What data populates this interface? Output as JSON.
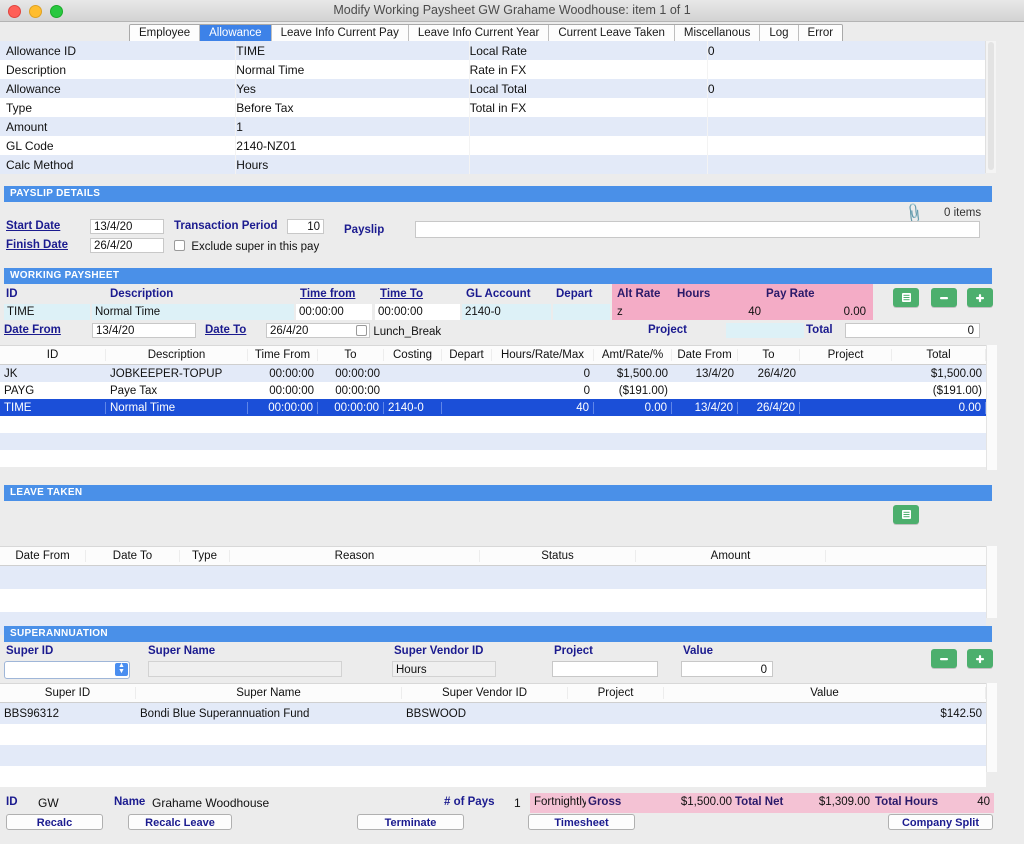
{
  "window": {
    "title": "Modify Working Paysheet GW Grahame Woodhouse: item 1  of  1"
  },
  "tabs": [
    {
      "label": "Employee",
      "active": false
    },
    {
      "label": "Allowance",
      "active": true
    },
    {
      "label": "Leave Info Current Pay",
      "active": false
    },
    {
      "label": "Leave Info Current Year",
      "active": false
    },
    {
      "label": "Current Leave Taken",
      "active": false
    },
    {
      "label": "Miscellanous",
      "active": false
    },
    {
      "label": "Log",
      "active": false
    },
    {
      "label": "Error",
      "active": false
    }
  ],
  "allowance_detail": {
    "left": [
      {
        "label": "Allowance ID",
        "value": "TIME"
      },
      {
        "label": "Description",
        "value": "Normal Time"
      },
      {
        "label": "Allowance",
        "value": "Yes"
      },
      {
        "label": "Type",
        "value": "Before Tax"
      },
      {
        "label": "Amount",
        "value": "1"
      },
      {
        "label": "GL Code",
        "value": "2140-NZ01"
      },
      {
        "label": "Calc Method",
        "value": "Hours"
      }
    ],
    "right": [
      {
        "label": "Local Rate",
        "value": "0"
      },
      {
        "label": "Rate in FX",
        "value": ""
      },
      {
        "label": "Local Total",
        "value": "0"
      },
      {
        "label": "Total in FX",
        "value": ""
      },
      {
        "label": "",
        "value": ""
      },
      {
        "label": "",
        "value": ""
      },
      {
        "label": "",
        "value": ""
      }
    ]
  },
  "payslip_details": {
    "section_title": "PAYSLIP DETAILS",
    "attachment_count": "0 items",
    "attachment_icon": "paperclip-icon",
    "start_date_label": "Start Date",
    "start_date_value": "13/4/20",
    "finish_date_label": "Finish Date",
    "finish_date_value": "26/4/20",
    "transaction_period_label": "Transaction Period",
    "transaction_period_value": "10",
    "exclude_super_label": "Exclude super in this pay",
    "exclude_super_checked": false,
    "payslip_label": "Payslip",
    "payslip_value": ""
  },
  "working_paysheet": {
    "section_title": "WORKING PAYSHEET",
    "form_labels": {
      "id": "ID",
      "description": "Description",
      "time_from": "Time from",
      "time_to": "Time To",
      "gl_account": "GL Account",
      "depart": "Depart",
      "alt_rate": "Alt Rate",
      "hours": "Hours",
      "pay_rate": "Pay Rate",
      "date_from": "Date From",
      "date_to": "Date To",
      "lunch_break": "Lunch_Break",
      "project": "Project",
      "total": "Total"
    },
    "form_values": {
      "id": "TIME",
      "description": "Normal Time",
      "time_from": "00:00:00",
      "time_to": "00:00:00",
      "gl_account": "2140-0",
      "depart": "",
      "alt_rate": "z",
      "hours": "40",
      "pay_rate": "0.00",
      "date_from": "13/4/20",
      "date_to": "26/4/20",
      "lunch_break_checked": false,
      "project": "",
      "total": "0"
    },
    "buttons": {
      "list": "list-icon",
      "minus": "minus-icon",
      "plus": "plus-icon"
    },
    "columns": [
      "ID",
      "Description",
      "Time From",
      "To",
      "Costing",
      "Depart",
      "Hours/Rate/Max",
      "Amt/Rate/%",
      "Date From",
      "To",
      "Project",
      "Total"
    ],
    "rows": [
      {
        "id": "JK",
        "description": "JOBKEEPER-TOPUP",
        "time_from": "00:00:00",
        "to": "00:00:00",
        "costing": "",
        "depart": "",
        "hours": "0",
        "amt": "$1,500.00",
        "date_from": "13/4/20",
        "date_to": "26/4/20",
        "project": "",
        "total": "$1,500.00",
        "style": "alt"
      },
      {
        "id": "PAYG",
        "description": "Paye Tax",
        "time_from": "00:00:00",
        "to": "00:00:00",
        "costing": "",
        "depart": "",
        "hours": "0",
        "amt": "($191.00)",
        "date_from": "",
        "date_to": "",
        "project": "",
        "total": "($191.00)",
        "style": "plain"
      },
      {
        "id": "TIME",
        "description": "Normal Time",
        "time_from": "00:00:00",
        "to": "00:00:00",
        "costing": "2140-0",
        "depart": "",
        "hours": "40",
        "amt": "0.00",
        "date_from": "13/4/20",
        "date_to": "26/4/20",
        "project": "",
        "total": "0.00",
        "style": "sel"
      },
      {
        "id": "",
        "description": "",
        "time_from": "",
        "to": "",
        "costing": "",
        "depart": "",
        "hours": "",
        "amt": "",
        "date_from": "",
        "date_to": "",
        "project": "",
        "total": "",
        "style": "plain"
      },
      {
        "id": "",
        "description": "",
        "time_from": "",
        "to": "",
        "costing": "",
        "depart": "",
        "hours": "",
        "amt": "",
        "date_from": "",
        "date_to": "",
        "project": "",
        "total": "",
        "style": "alt"
      },
      {
        "id": "",
        "description": "",
        "time_from": "",
        "to": "",
        "costing": "",
        "depart": "",
        "hours": "",
        "amt": "",
        "date_from": "",
        "date_to": "",
        "project": "",
        "total": "",
        "style": "plain"
      }
    ]
  },
  "leave_taken": {
    "section_title": "LEAVE TAKEN",
    "list_button": "list-icon",
    "columns": [
      "Date From",
      "Date To",
      "Type",
      "Reason",
      "Status",
      "Amount"
    ],
    "rows": [
      {
        "date_from": "",
        "date_to": "",
        "type": "",
        "reason": "",
        "status": "",
        "amount": "",
        "style": "alt"
      },
      {
        "date_from": "",
        "date_to": "",
        "type": "",
        "reason": "",
        "status": "",
        "amount": "",
        "style": "plain"
      },
      {
        "date_from": "",
        "date_to": "",
        "type": "",
        "reason": "",
        "status": "",
        "amount": "",
        "style": "alt"
      }
    ]
  },
  "superannuation": {
    "section_title": "SUPERANNUATION",
    "form_labels": {
      "super_id": "Super ID",
      "super_name": "Super Name",
      "super_vendor_id": "Super Vendor ID",
      "project": "Project",
      "value": "Value"
    },
    "form_values": {
      "super_id": "",
      "super_name": "",
      "super_vendor_id": "Hours",
      "project": "",
      "value": "0"
    },
    "buttons": {
      "minus": "minus-icon",
      "plus": "plus-icon"
    },
    "columns": [
      "Super ID",
      "Super Name",
      "Super Vendor ID",
      "Project",
      "Value"
    ],
    "rows": [
      {
        "super_id": "BBS96312",
        "super_name": "Bondi Blue Superannuation Fund",
        "super_vendor_id": "BBSWOOD",
        "project": "",
        "value": "$142.50",
        "style": "alt"
      },
      {
        "super_id": "",
        "super_name": "",
        "super_vendor_id": "",
        "project": "",
        "value": "",
        "style": "plain"
      },
      {
        "super_id": "",
        "super_name": "",
        "super_vendor_id": "",
        "project": "",
        "value": "",
        "style": "alt"
      },
      {
        "super_id": "",
        "super_name": "",
        "super_vendor_id": "",
        "project": "",
        "value": "",
        "style": "plain"
      }
    ]
  },
  "footer": {
    "id_label": "ID",
    "id_value": "GW",
    "name_label": "Name",
    "name_value": "Grahame Woodhouse",
    "pays_label": "# of Pays",
    "pays_value": "1",
    "frequency": "Fortnightly",
    "gross_label": "Gross",
    "gross_value": "$1,500.00",
    "total_net_label": "Total Net",
    "total_net_value": "$1,309.00",
    "total_hours_label": "Total Hours",
    "total_hours_value": "40",
    "buttons": {
      "recalc": "Recalc",
      "recalc_leave": "Recalc Leave",
      "terminate": "Terminate",
      "timesheet": "Timesheet",
      "company_split": "Company Split"
    }
  },
  "colors": {
    "section_bar": "#4a90e8",
    "selected_row": "#1b4fd8",
    "accent_pink": "#f4acc6",
    "green_button": "#4caf6d",
    "label_blue": "#1b1b8f"
  }
}
